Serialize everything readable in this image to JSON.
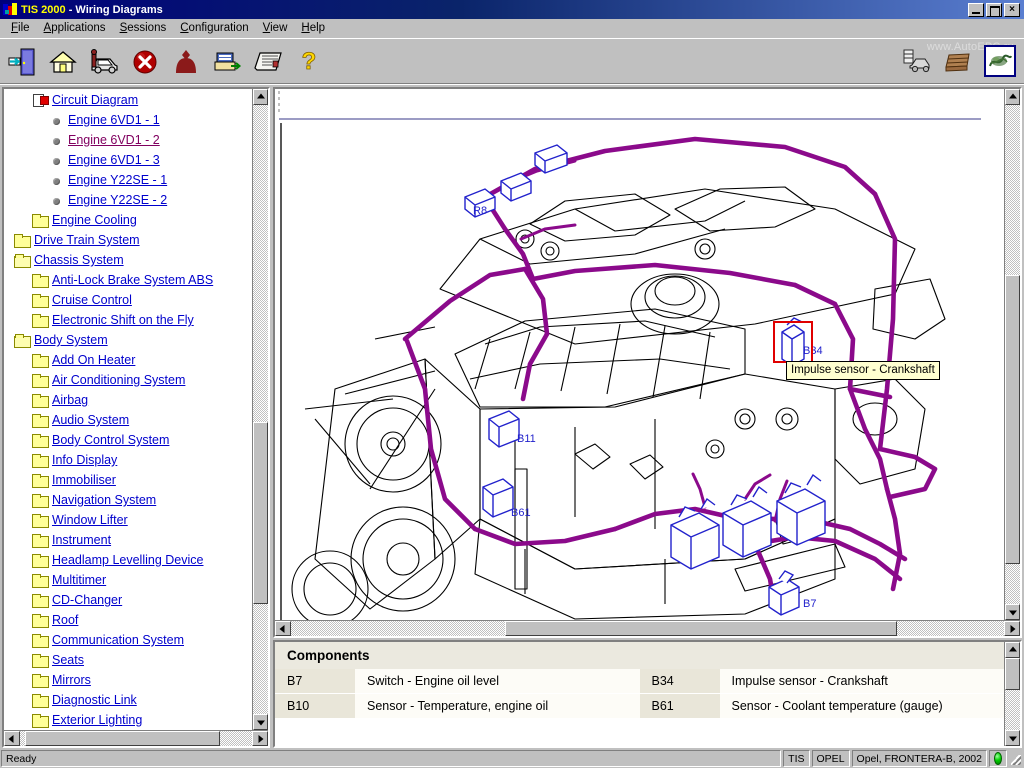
{
  "window": {
    "title_app": "TIS 2000",
    "title_rest": " - Wiring Diagrams",
    "minimize_label": "_",
    "maximize_label": "",
    "close_label": "×"
  },
  "menu": {
    "items": [
      {
        "label": "File",
        "accel": "F"
      },
      {
        "label": "Applications",
        "accel": "A"
      },
      {
        "label": "Sessions",
        "accel": "S"
      },
      {
        "label": "Configuration",
        "accel": "C"
      },
      {
        "label": "View",
        "accel": "V"
      },
      {
        "label": "Help",
        "accel": "H"
      }
    ]
  },
  "toolbar": {
    "watermark": "www.AutoEPC.ru",
    "buttons": [
      {
        "name": "exit-icon",
        "title": "Exit"
      },
      {
        "name": "home-icon",
        "title": "Home"
      },
      {
        "name": "vehicle-icon",
        "title": "Vehicle selection"
      },
      {
        "name": "cancel-icon",
        "title": "Cancel"
      },
      {
        "name": "person-icon",
        "title": "User"
      },
      {
        "name": "print-icon",
        "title": "Print"
      },
      {
        "name": "news-icon",
        "title": "News"
      },
      {
        "name": "help-icon",
        "title": "Help"
      }
    ],
    "right_buttons": [
      {
        "name": "vehicle-lift-icon",
        "title": "Vehicle data",
        "selected": false
      },
      {
        "name": "books-icon",
        "title": "Documentation",
        "selected": false
      },
      {
        "name": "wiring-diagram-icon",
        "title": "Wiring diagrams",
        "selected": true
      }
    ]
  },
  "sidebar": {
    "items": [
      {
        "label": "Circuit Diagram",
        "icon": "document-icon",
        "indent": 1,
        "visited": false
      },
      {
        "label": "Engine 6VD1 - 1",
        "icon": "bullet-icon",
        "indent": 2,
        "visited": false
      },
      {
        "label": "Engine 6VD1 - 2",
        "icon": "bullet-icon",
        "indent": 2,
        "visited": true
      },
      {
        "label": "Engine 6VD1 - 3",
        "icon": "bullet-icon",
        "indent": 2,
        "visited": false
      },
      {
        "label": "Engine Y22SE - 1",
        "icon": "bullet-icon",
        "indent": 2,
        "visited": false
      },
      {
        "label": "Engine Y22SE - 2",
        "icon": "bullet-icon",
        "indent": 2,
        "visited": false
      },
      {
        "label": "Engine Cooling",
        "icon": "folder-icon",
        "indent": 1,
        "visited": false
      },
      {
        "label": "Drive Train System",
        "icon": "folder-icon",
        "indent": 0,
        "visited": false
      },
      {
        "label": "Chassis System",
        "icon": "folder-open-icon",
        "indent": 0,
        "visited": false
      },
      {
        "label": "Anti-Lock Brake System ABS",
        "icon": "folder-icon",
        "indent": 1,
        "visited": false
      },
      {
        "label": "Cruise Control",
        "icon": "folder-icon",
        "indent": 1,
        "visited": false
      },
      {
        "label": "Electronic Shift on the Fly",
        "icon": "folder-icon",
        "indent": 1,
        "visited": false
      },
      {
        "label": "Body System",
        "icon": "folder-open-icon",
        "indent": 0,
        "visited": false
      },
      {
        "label": "Add On Heater",
        "icon": "folder-icon",
        "indent": 1,
        "visited": false
      },
      {
        "label": "Air Conditioning System",
        "icon": "folder-icon",
        "indent": 1,
        "visited": false
      },
      {
        "label": "Airbag",
        "icon": "folder-icon",
        "indent": 1,
        "visited": false
      },
      {
        "label": "Audio System",
        "icon": "folder-icon",
        "indent": 1,
        "visited": false
      },
      {
        "label": "Body Control System",
        "icon": "folder-icon",
        "indent": 1,
        "visited": false
      },
      {
        "label": "Info Display",
        "icon": "folder-icon",
        "indent": 1,
        "visited": false
      },
      {
        "label": "Immobiliser",
        "icon": "folder-icon",
        "indent": 1,
        "visited": false
      },
      {
        "label": "Navigation System",
        "icon": "folder-icon",
        "indent": 1,
        "visited": false
      },
      {
        "label": "Window Lifter",
        "icon": "folder-icon",
        "indent": 1,
        "visited": false
      },
      {
        "label": "Instrument",
        "icon": "folder-icon",
        "indent": 1,
        "visited": false
      },
      {
        "label": "Headlamp Levelling Device",
        "icon": "folder-icon",
        "indent": 1,
        "visited": false
      },
      {
        "label": "Multitimer",
        "icon": "folder-icon",
        "indent": 1,
        "visited": false
      },
      {
        "label": "CD-Changer",
        "icon": "folder-icon",
        "indent": 1,
        "visited": false
      },
      {
        "label": "Roof",
        "icon": "folder-icon",
        "indent": 1,
        "visited": false
      },
      {
        "label": "Communication System",
        "icon": "folder-icon",
        "indent": 1,
        "visited": false
      },
      {
        "label": "Seats",
        "icon": "folder-icon",
        "indent": 1,
        "visited": false
      },
      {
        "label": "Mirrors",
        "icon": "folder-icon",
        "indent": 1,
        "visited": false
      },
      {
        "label": "Diagnostic Link",
        "icon": "folder-icon",
        "indent": 1,
        "visited": false
      },
      {
        "label": "Exterior Lighting",
        "icon": "folder-icon",
        "indent": 1,
        "visited": false
      }
    ]
  },
  "diagram": {
    "tooltip": "Impulse sensor - Crankshaft",
    "selected_component": "B34",
    "callouts": [
      "R8",
      "B11",
      "B61",
      "B34",
      "B7"
    ],
    "colors": {
      "harness": "#8B0A8B",
      "connector": "#2222cc",
      "outline": "#000000",
      "selection": "#e00000",
      "tooltip_bg": "#ffffd0"
    }
  },
  "components": {
    "title": "Components",
    "rows": [
      {
        "code1": "B7",
        "desc1": "Switch - Engine oil level",
        "code2": "B34",
        "desc2": "Impulse sensor - Crankshaft"
      },
      {
        "code1": "B10",
        "desc1": "Sensor - Temperature, engine oil",
        "code2": "B61",
        "desc2": "Sensor - Coolant temperature (gauge)"
      }
    ]
  },
  "statusbar": {
    "ready": "Ready",
    "system": "TIS",
    "brand": "OPEL",
    "vehicle": "Opel, FRONTERA-B, 2002"
  }
}
